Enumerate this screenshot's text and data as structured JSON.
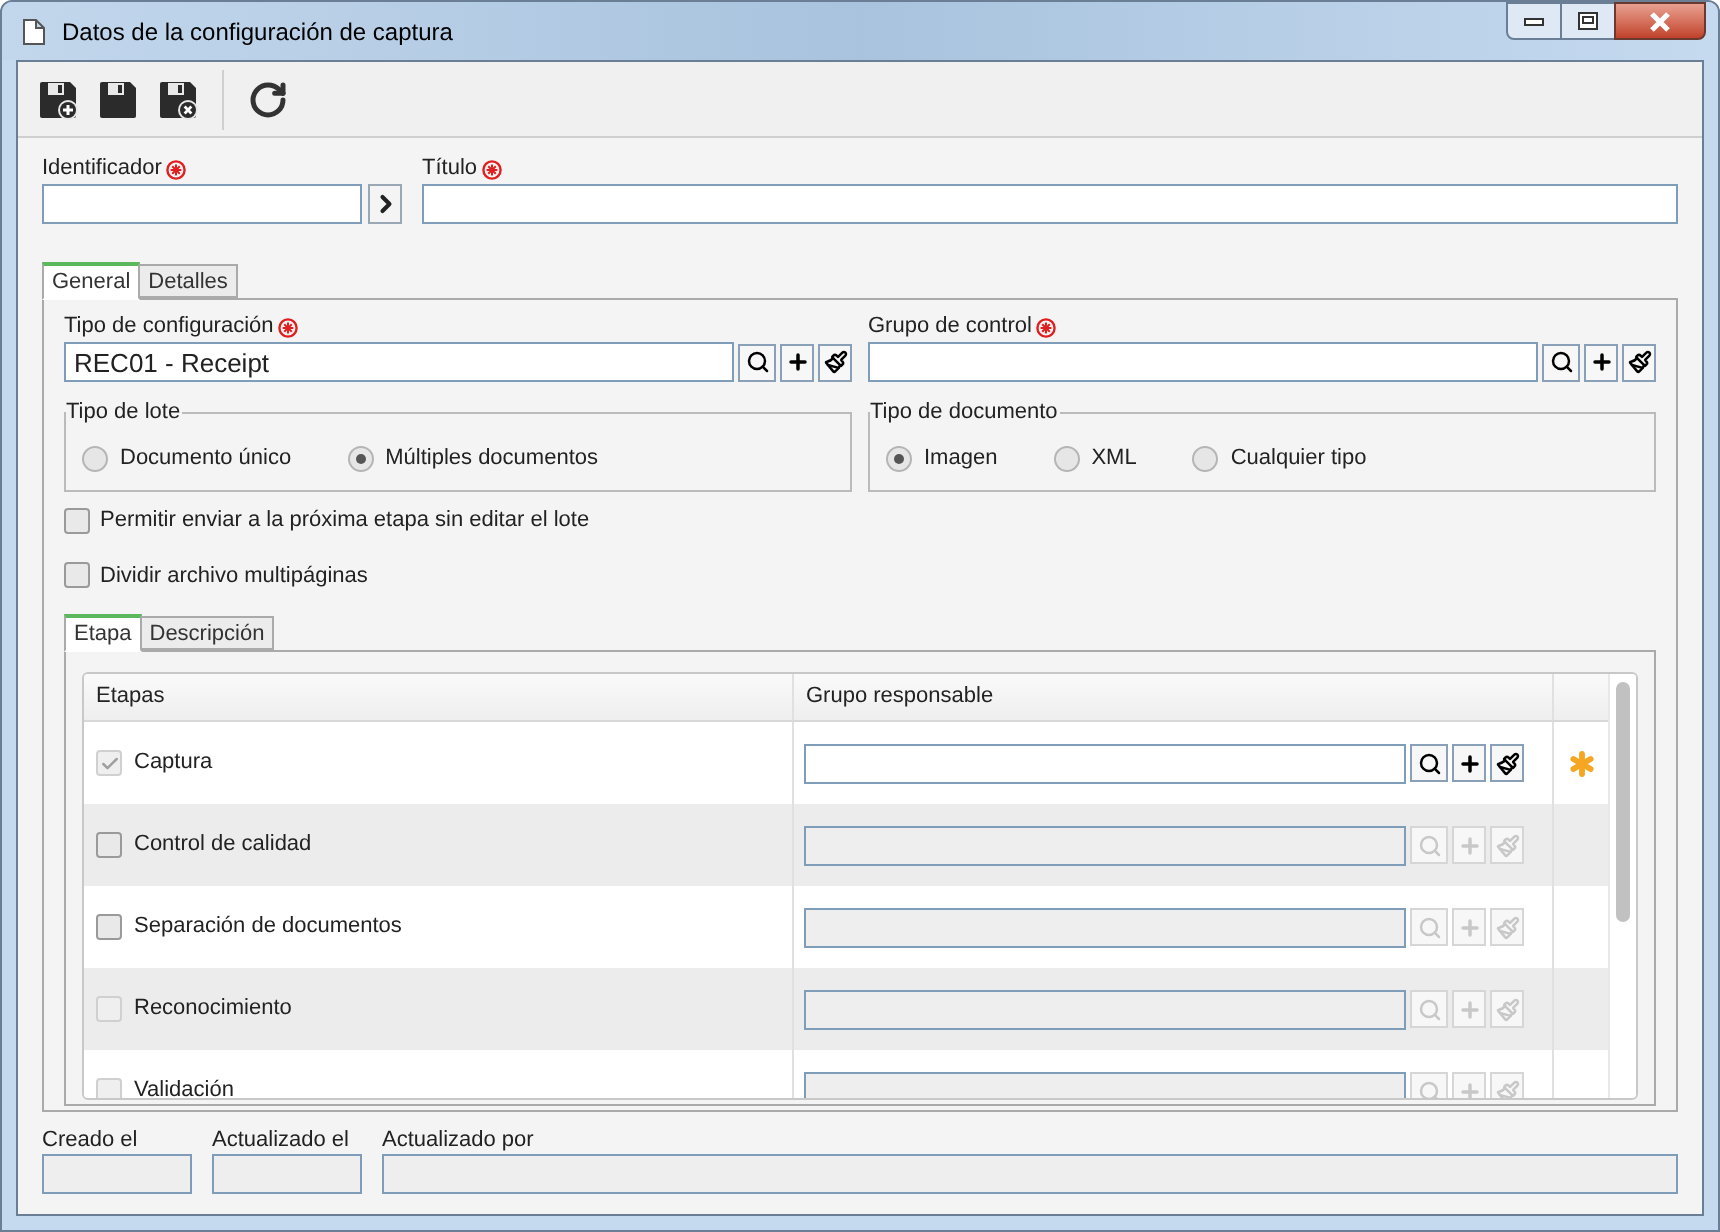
{
  "window": {
    "title": "Datos de la configuración de captura"
  },
  "header_fields": [
    {
      "label": "Identificador",
      "required": true,
      "kind": "arrow"
    },
    {
      "label": "Título",
      "required": true,
      "kind": "plain"
    }
  ],
  "tabs": [
    {
      "label": "General",
      "selected": true
    },
    {
      "label": "Detalles",
      "selected": false
    }
  ],
  "lookup_fields": [
    {
      "label": "Tipo de configuración",
      "required": true,
      "value": "REC01 - Receipt"
    },
    {
      "label": "Grupo de control",
      "required": true
    }
  ],
  "radio_groups": [
    {
      "legend": "Tipo de lote",
      "options": [
        {
          "label": "Documento único",
          "selected": false
        },
        {
          "label": "Múltiples documentos",
          "selected": true
        }
      ]
    },
    {
      "legend": "Tipo de documento",
      "options": [
        {
          "label": "Imagen",
          "selected": true
        },
        {
          "label": "XML",
          "selected": false
        },
        {
          "label": "Cualquier tipo",
          "selected": false
        }
      ]
    }
  ],
  "checkboxes": [
    {
      "label": "Permitir enviar a la próxima etapa sin editar el lote",
      "checked": false
    },
    {
      "label": "Dividir archivo multipáginas",
      "checked": false
    }
  ],
  "inner_tabs": [
    {
      "label": "Etapa",
      "selected": true
    },
    {
      "label": "Descripción",
      "selected": false
    }
  ],
  "table": {
    "columns": [
      "Etapas",
      "Grupo responsable"
    ],
    "rows": [
      {
        "stage": "Captura",
        "checked": true,
        "disabled": true,
        "field_enabled": true,
        "flagged": true
      },
      {
        "stage": "Control de calidad",
        "checked": false,
        "disabled": false,
        "field_enabled": false,
        "flagged": false
      },
      {
        "stage": "Separación de documentos",
        "checked": false,
        "disabled": false,
        "field_enabled": false,
        "flagged": false
      },
      {
        "stage": "Reconocimiento",
        "checked": false,
        "disabled": true,
        "field_enabled": false,
        "flagged": false
      },
      {
        "stage": "Validación",
        "checked": false,
        "disabled": true,
        "field_enabled": false,
        "flagged": false
      }
    ]
  },
  "footer_fields": [
    {
      "label": "Creado el"
    },
    {
      "label": "Actualizado el"
    },
    {
      "label": "Actualizado por"
    }
  ]
}
